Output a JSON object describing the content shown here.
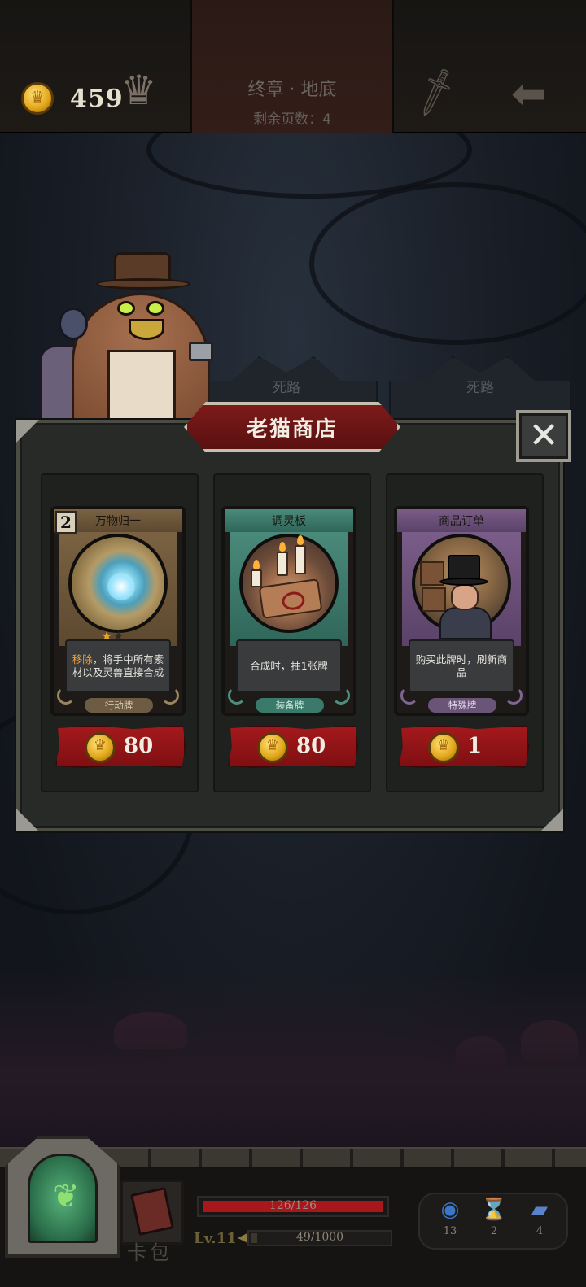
{
  "header": {
    "gold_amount": "459",
    "chapter_title": "终章 · 地底",
    "pages_remaining": "剩余页数：4"
  },
  "paths": [
    {
      "label": "死路"
    },
    {
      "label": "死路"
    }
  ],
  "shop": {
    "title": "老猫商店",
    "items": [
      {
        "card_name": "万物归一",
        "cost_badge": "2",
        "description_keyword": "移除",
        "description_rest": "，将手中所有素材以及灵兽直接合成",
        "card_type": "行动牌",
        "price": "80",
        "stars_filled": 1,
        "stars_total": 2
      },
      {
        "card_name": "调灵板",
        "description": "合成时，抽1张牌",
        "card_type": "装备牌",
        "price": "80"
      },
      {
        "card_name": "商品订单",
        "description": "购买此牌时，刷新商品",
        "card_type": "特殊牌",
        "price": "1"
      }
    ]
  },
  "hud": {
    "card_pack_label": "卡包",
    "hp_text": "126/126",
    "hp_fraction": 1.0,
    "level_text": "Lv.11",
    "xp_text": "49/1000",
    "xp_fraction": 0.049,
    "resources": [
      {
        "icon": "orb-icon",
        "value": "13"
      },
      {
        "icon": "hourglass-icon",
        "value": "2"
      },
      {
        "icon": "cards-icon",
        "value": "4"
      }
    ]
  },
  "colors": {
    "price_red": "#a3191c",
    "gold": "#e0a418",
    "keyword_orange": "#e9a23a"
  }
}
